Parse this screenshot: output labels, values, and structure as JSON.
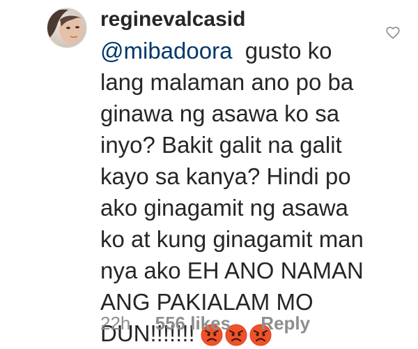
{
  "comment": {
    "username": "reginevalcasid",
    "mention": "@mibadoora",
    "lines": [
      "gusto ko",
      "lang malaman ano po ba",
      "ginawa ng asawa ko sa",
      "inyo? Bakit galit na galit",
      "kayo sa kanya? Hindi po",
      "ako ginagamit ng asawa",
      "ko at kung ginagamit man",
      "nya ako EH ANO NAMAN",
      "ANG PAKIALAM MO",
      "DUN!!!!!!!"
    ],
    "emojis": [
      "angry-face-icon",
      "angry-face-icon",
      "angry-face-icon"
    ],
    "time": "22h",
    "likes": "556 likes",
    "reply_label": "Reply"
  },
  "colors": {
    "text": "#262626",
    "mention": "#00376b",
    "meta": "#8e8e8e",
    "emoji_face": "#f0512a"
  },
  "icons": {
    "like": "heart-outline-icon",
    "avatar": "profile-photo"
  }
}
